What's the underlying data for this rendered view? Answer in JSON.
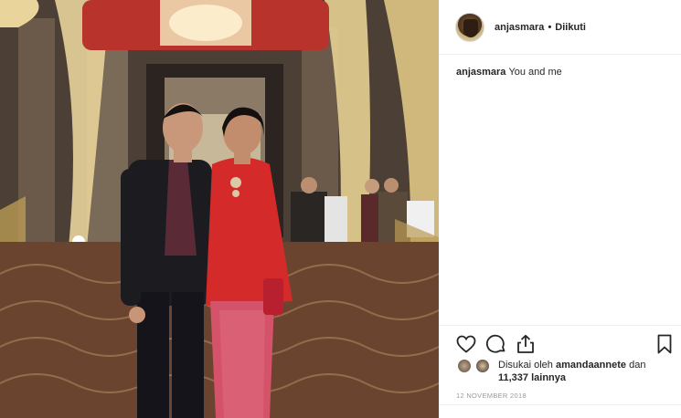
{
  "post": {
    "username": "anjasmara",
    "separator": "•",
    "follow_status": "Diikuti",
    "caption_user": "anjasmara",
    "caption_text": "You and me",
    "likes_prefix": "Disukai oleh",
    "likes_user": "amandaannete",
    "likes_and": "dan",
    "likes_count": "11,337 lainnya",
    "date": "12 NOVEMBER 2018"
  },
  "icons": {
    "like": "heart-icon",
    "comment": "comment-icon",
    "share": "share-icon",
    "save": "bookmark-icon"
  },
  "colors": {
    "text": "#262626",
    "muted": "#999999",
    "border": "#efefef",
    "dress_red": "#d42a2a"
  }
}
